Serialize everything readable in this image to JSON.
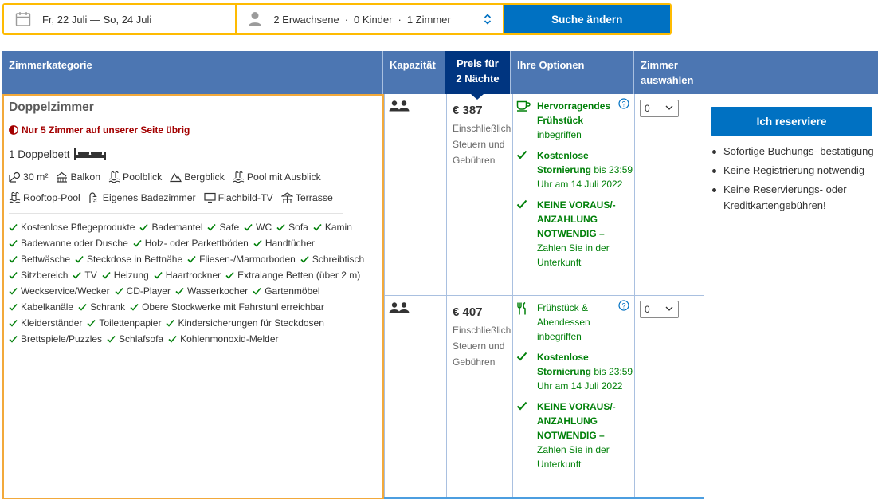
{
  "search": {
    "dates": "Fr, 22 Juli — So, 24 Juli",
    "adults": "2 Erwachsene",
    "children": "0 Kinder",
    "rooms": "1 Zimmer",
    "button": "Suche ändern"
  },
  "table_header": {
    "category": "Zimmerkategorie",
    "capacity": "Kapazität",
    "price_line1": "Preis für",
    "price_line2": "2 Nächte",
    "options": "Ihre Optionen",
    "select_line1": "Zimmer",
    "select_line2": "auswählen"
  },
  "room": {
    "name": "Doppelzimmer",
    "scarcity": "Nur 5 Zimmer auf unserer Seite übrig",
    "bed": "1 Doppelbett",
    "facilities": [
      {
        "icon": "size-icon",
        "label": "30 m²"
      },
      {
        "icon": "balcony-icon",
        "label": "Balkon"
      },
      {
        "icon": "pool-icon",
        "label": "Poolblick"
      },
      {
        "icon": "mountain-icon",
        "label": "Bergblick"
      },
      {
        "icon": "pool-icon",
        "label": "Pool mit Ausblick"
      },
      {
        "icon": "pool-icon",
        "label": "Rooftop-Pool"
      },
      {
        "icon": "shower-icon",
        "label": "Eigenes Badezimmer"
      },
      {
        "icon": "tv-icon",
        "label": "Flachbild-TV"
      },
      {
        "icon": "terrace-icon",
        "label": "Terrasse"
      }
    ],
    "amenities": [
      "Kostenlose Pflegeprodukte",
      "Bademantel",
      "Safe",
      "WC",
      "Sofa",
      "Kamin",
      "Badewanne oder Dusche",
      "Holz- oder Parkettböden",
      "Handtücher",
      "Bettwäsche",
      "Steckdose in Bettnähe",
      "Fliesen-/Marmorboden",
      "Schreibtisch",
      "Sitzbereich",
      "TV",
      "Heizung",
      "Haartrockner",
      "Extralange Betten (über 2 m)",
      "Weckservice/Wecker",
      "CD-Player",
      "Wasserkocher",
      "Gartenmöbel",
      "Kabelkanäle",
      "Schrank",
      "Obere Stockwerke mit Fahrstuhl erreichbar",
      "Kleiderständer",
      "Toilettenpapier",
      "Kindersicherungen für Steckdosen",
      "Brettspiele/Puzzles",
      "Schlafsofa",
      "Kohlenmonoxid-Melder"
    ]
  },
  "offers": [
    {
      "price": "€ 387",
      "price_note": "Einschließlich Steuern und Gebühren",
      "meal_icon": "coffee-cup-icon",
      "meal_bold": "Hervorragendes Frühstück",
      "meal_rest": "inbegriffen",
      "cancel_bold": "Kostenlose Stornierung",
      "cancel_rest": "bis 23:59 Uhr am 14 Juli 2022",
      "prepay_bold": "KEINE VORAUS/-ANZAHLUNG NOTWENDIG –",
      "prepay_rest": "Zahlen Sie in der Unterkunft",
      "qty": "0"
    },
    {
      "price": "€ 407",
      "price_note": "Einschließlich Steuern und Gebühren",
      "meal_icon": "fork-knife-icon",
      "meal_bold": "",
      "meal_rest": "Frühstück & Abendessen inbegriffen",
      "cancel_bold": "Kostenlose Stornierung",
      "cancel_rest": "bis 23:59 Uhr am 14 Juli 2022",
      "prepay_bold": "KEINE VORAUS/-ANZAHLUNG NOTWENDIG –",
      "prepay_rest": "Zahlen Sie in der Unterkunft",
      "qty": "0"
    }
  ],
  "reserve": {
    "button": "Ich reserviere",
    "benefits": [
      "Sofortige Buchungs- bestätigung",
      "Keine Registrierung notwendig",
      "Keine Reservierungs- oder Kreditkartengebühren!"
    ]
  },
  "colors": {
    "brand_blue": "#0071c2",
    "header_blue": "#4c76b2",
    "dark_blue": "#003580",
    "yellow": "#febb02",
    "green": "#008009",
    "red": "#a30000"
  }
}
